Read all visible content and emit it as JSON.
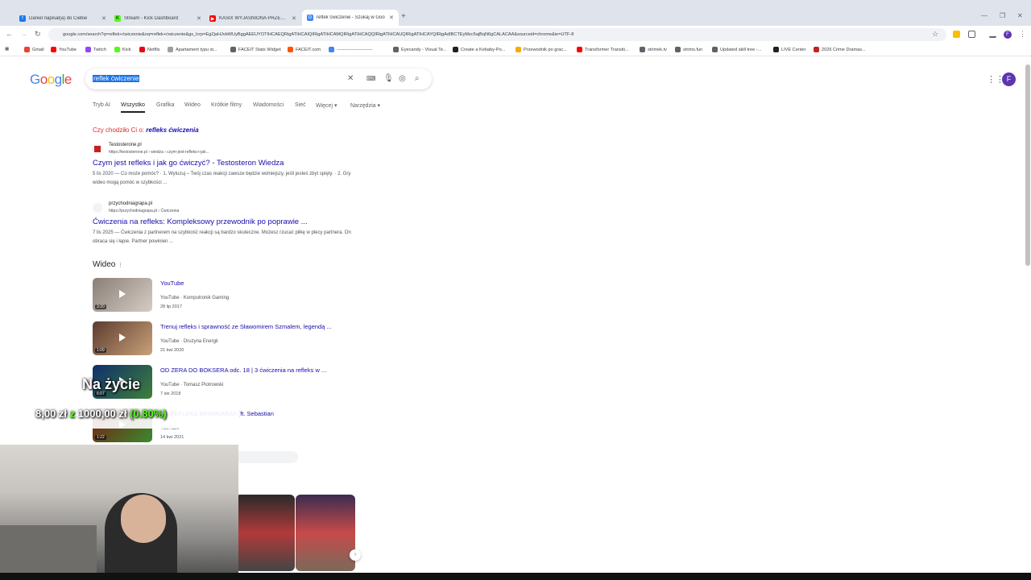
{
  "browser": {
    "tabs": [
      {
        "label": "Daniel napisał(a) do Ciebie",
        "color": "#1877f2"
      },
      {
        "label": "Stream - Kick Dashboard",
        "color": "#53fc18"
      },
      {
        "label": "KASIX WYJAŚNIONA PRZEZ KA",
        "color": "#ff0000"
      },
      {
        "label": "reflek ćwiczenie - Szukaj w Goo",
        "color": "#4285f4"
      }
    ],
    "url": "google.com/search?q=reflek+ćwiczenie&oq=reflek+ćwiczenie&gs_lcrp=EgZjaHJvbWUyBggAEEUYOTIHCAEQRigATIHCAIQIRigATIHCAMQIRigATIHCAQQIRigATIHCAUQIRigATIHCAYQIRigAdIBCTEyMzc5ajBqN6gCALACAA&sourceid=chrome&ie=UTF-8",
    "bookmarks": [
      {
        "label": "Gmail",
        "color": "#ea4335"
      },
      {
        "label": "YouTube",
        "color": "#ff0000"
      },
      {
        "label": "Twitch",
        "color": "#9146ff"
      },
      {
        "label": "Kick",
        "color": "#53fc18"
      },
      {
        "label": "Netflix",
        "color": "#e50914"
      },
      {
        "label": "Apartament typu st...",
        "color": "#9aa0a6"
      },
      {
        "label": "FACEIT Stats Widget",
        "color": "#5f6368"
      },
      {
        "label": "FACEIT.com",
        "color": "#ff5500"
      },
      {
        "label": "------------------------",
        "color": "#4285f4"
      },
      {
        "label": "Eyecandy - Visual Te...",
        "color": "#5f6368"
      },
      {
        "label": "Create a Kebaby-Po...",
        "color": "#202124"
      },
      {
        "label": "Przewodnik po grac...",
        "color": "#f9ab00"
      },
      {
        "label": "Transformer Transiti...",
        "color": "#ff0000"
      },
      {
        "label": "strimek.tv",
        "color": "#5f6368"
      },
      {
        "label": "strims.fun",
        "color": "#5f6368"
      },
      {
        "label": "Updated skill tree -...",
        "color": "#5f6368"
      },
      {
        "label": "LIVE Center",
        "color": "#202124"
      },
      {
        "label": "2026 Crime Dramas...",
        "color": "#c5221f"
      }
    ],
    "profile_initial": "F"
  },
  "google": {
    "logo": "Google",
    "query": "reflek ćwiczenie",
    "tabs": [
      "Tryb AI",
      "Wszystko",
      "Grafika",
      "Wideo",
      "Krótkie filmy",
      "Wiadomości",
      "Sieć",
      "Więcej",
      "Narzędzia"
    ],
    "did_you_mean_prefix": "Czy chodziło Ci o:",
    "did_you_mean_term": "refleks ćwiczenia",
    "results": [
      {
        "site": "Testosterone.pl",
        "url": "https://testosterone.pl › wiedza › czym-jest-refleks-i-jak...",
        "title": "Czym jest refleks i jak go ćwiczyć? - Testosteron Wiedza",
        "snippet": "5 lis 2020 — Co może pomóc? · 1. Wyluzuj – Twój czas reakcji zawsze będzie wolniejszy, jeśli jesteś zbyt spięty. · 2. Gry wideo mogą pomóc w szybkości ..."
      },
      {
        "site": "przychodniagrapa.pl",
        "url": "https://przychodniagrapa.pl › Ćwiczenia",
        "title": "Ćwiczenia na refleks: Kompleksowy przewodnik po poprawie ...",
        "snippet": "7 lis 2025 — Ćwiczenia z partnerem na szybkość reakcji są bardzo skuteczne. Możesz rzucać piłkę w plecy partnera. On obraca się i łapie. Partner powinien ..."
      }
    ],
    "video_heading": "Wideo",
    "videos": [
      {
        "title": "YouTube",
        "source": "YouTube · Komputronik Gaming",
        "date": "28 lip 2017",
        "duration": "3:20"
      },
      {
        "title": "Trenuj refleks i sprawność ze Sławomirem Szmalem, legendą ...",
        "source": "YouTube · Drużyna Energii",
        "date": "21 kwi 2020",
        "duration": "1:09"
      },
      {
        "title": "OD ZERA DO BOKSERA odc. 18 | 3 ćwiczenia na refleks w ...",
        "source": "YouTube · Tomasz Piotrowski",
        "date": "7 sie 2018",
        "duration": "6:07"
      },
      {
        "title": "NA REFLEKS BRAMKARZA (ft. Sebastian",
        "source": "YouTube",
        "date": "14 kwi 2021",
        "duration": "1:22"
      }
    ],
    "more_videos": "›"
  },
  "overlay": {
    "donate_title": "Na życie",
    "amount_current": "8,00 zł",
    "amount_sep": "z",
    "amount_goal": "1000,00 zł",
    "percent": "(0.80%)",
    "accent": "#53fc18"
  }
}
